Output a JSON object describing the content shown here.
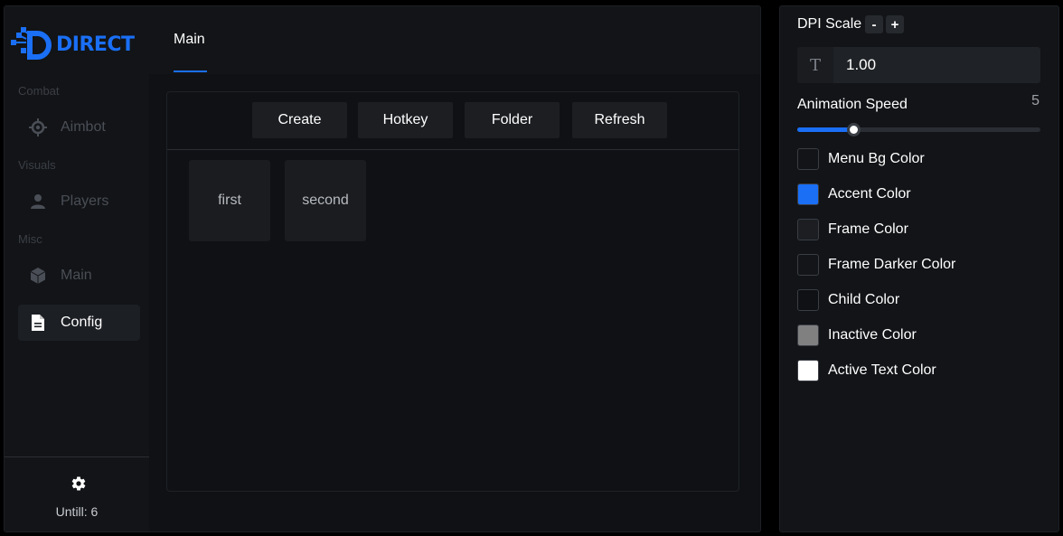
{
  "brand": {
    "name": "DIRECT",
    "accent": "#1a6ff5"
  },
  "sidebar": {
    "groups": [
      {
        "label": "Combat",
        "items": [
          {
            "label": "Aimbot",
            "icon": "crosshair-icon"
          }
        ]
      },
      {
        "label": "Visuals",
        "items": [
          {
            "label": "Players",
            "icon": "user-icon"
          }
        ]
      },
      {
        "label": "Misc",
        "items": [
          {
            "label": "Main",
            "icon": "cube-icon"
          },
          {
            "label": "Config",
            "icon": "document-icon",
            "active": true
          }
        ]
      }
    ],
    "footer": {
      "icon": "gear-icon",
      "until_text": "Untill: 6"
    }
  },
  "tabs": [
    {
      "label": "Main",
      "active": true
    }
  ],
  "toolbar": {
    "buttons": [
      "Create",
      "Hotkey",
      "Folder",
      "Refresh"
    ]
  },
  "configs": [
    "first",
    "second"
  ],
  "settings": {
    "dpi_scale": {
      "label": "DPI Scale",
      "minus": "-",
      "plus": "+",
      "value": "1.00",
      "icon": "T"
    },
    "animation_speed": {
      "label": "Animation Speed",
      "value": "5",
      "fill_fraction": 0.23
    },
    "colors": [
      {
        "label": "Menu Bg Color",
        "hex": "#121417"
      },
      {
        "label": "Accent Color",
        "hex": "#1a6ff5"
      },
      {
        "label": "Frame Color",
        "hex": "#1c1e22"
      },
      {
        "label": "Frame Darker Color",
        "hex": "#131518"
      },
      {
        "label": "Child Color",
        "hex": "#0f1114"
      },
      {
        "label": "Inactive Color",
        "hex": "#808080"
      },
      {
        "label": "Active Text Color",
        "hex": "#ffffff"
      }
    ]
  }
}
